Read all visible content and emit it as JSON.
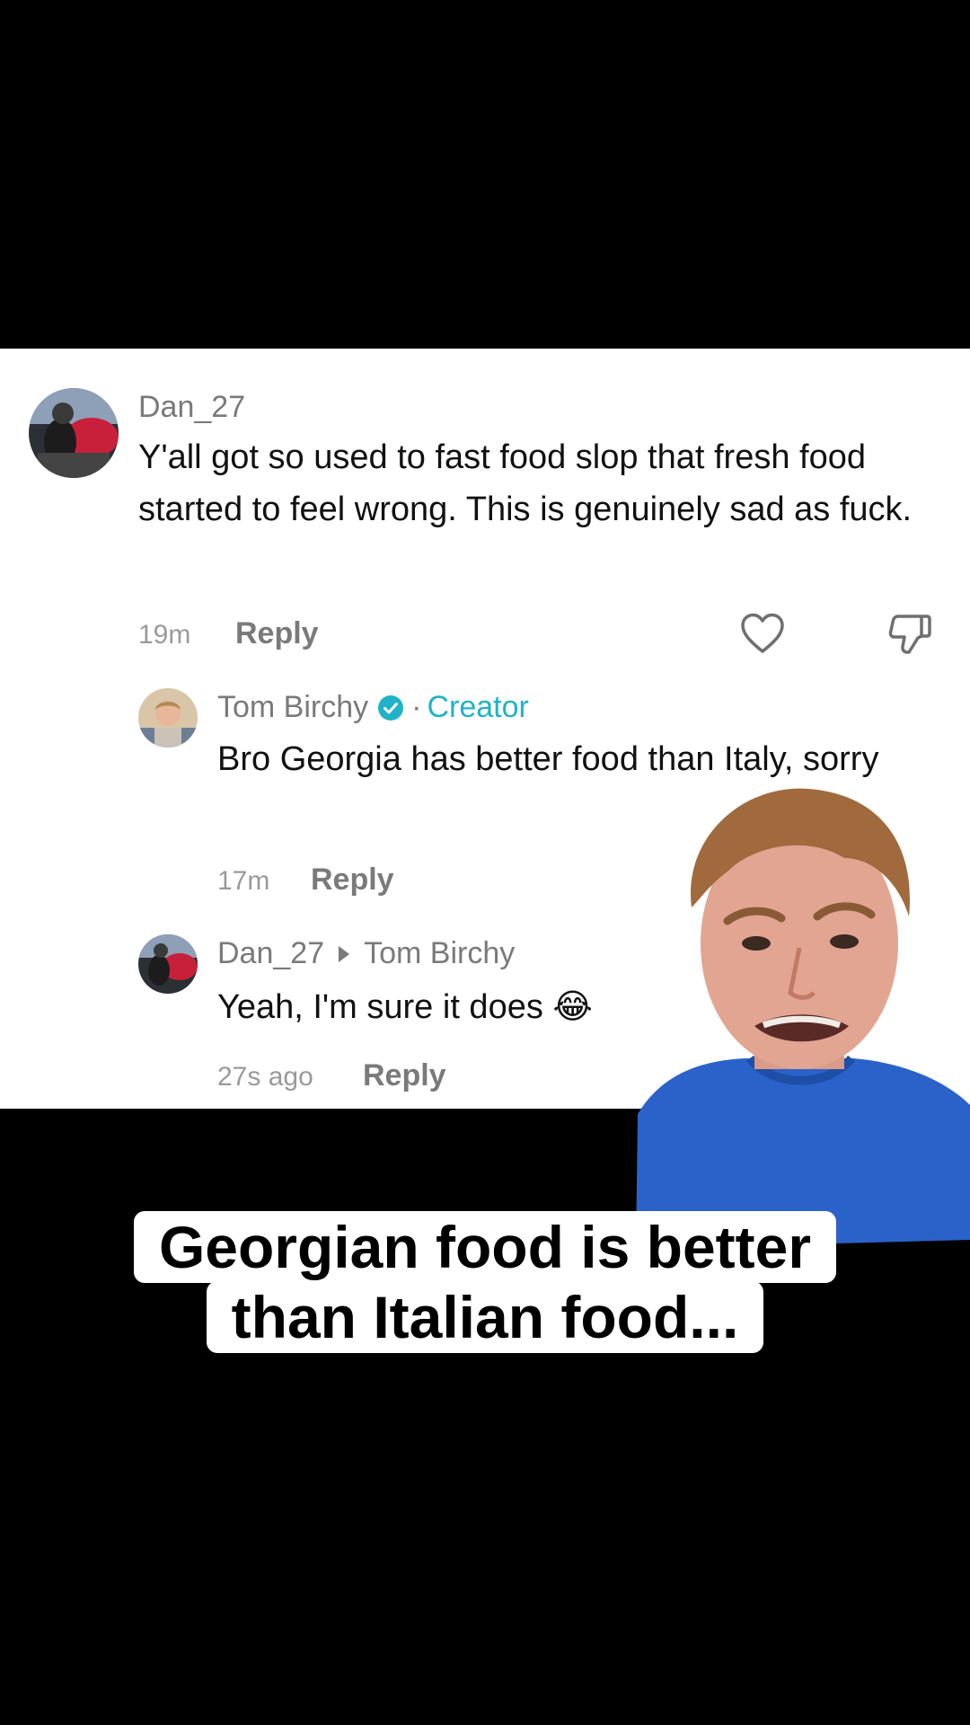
{
  "comments": {
    "main": {
      "username": "Dan_27",
      "text": "Y'all got so used to fast food slop that fresh food started to feel wrong. This is genuinely sad as fuck.",
      "time": "19m",
      "reply_label": "Reply"
    },
    "creator_reply": {
      "username": "Tom Birchy",
      "separator": "·",
      "badge": "Creator",
      "text": "Bro Georgia has better food than Italy, sorry",
      "time": "17m",
      "reply_label": "Reply"
    },
    "nested_reply": {
      "username": "Dan_27",
      "reply_to": "Tom Birchy",
      "text": "Yeah, I'm sure it does 😂",
      "time": "27s ago",
      "reply_label": "Reply"
    }
  },
  "icons": {
    "like": "heart-icon",
    "dislike": "thumbs-down-icon",
    "verified": "verified-check-icon"
  },
  "colors": {
    "accent": "#20b2c9",
    "background": "#000000",
    "card": "#ffffff"
  },
  "caption": {
    "line1": "Georgian food is better",
    "line2": "than Italian food..."
  }
}
